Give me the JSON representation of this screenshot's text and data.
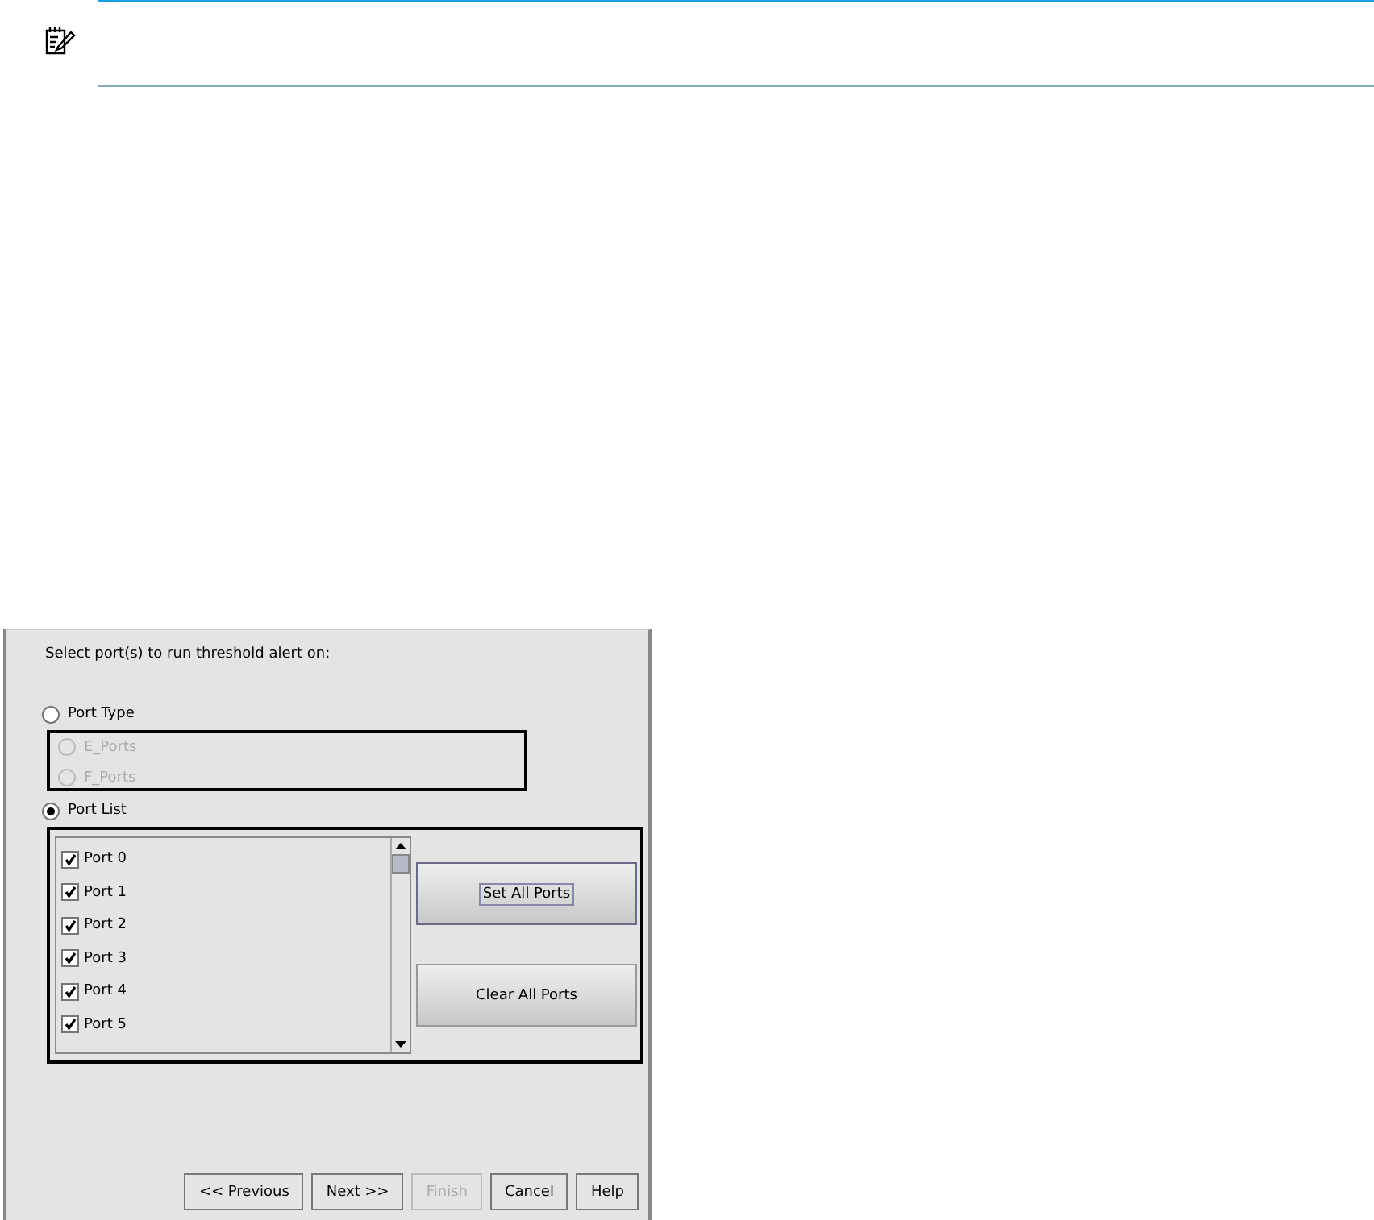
{
  "dialog": {
    "prompt": "Select port(s) to run threshold alert on:",
    "modes": [
      {
        "label": "Port Type",
        "selected": false
      },
      {
        "label": "Port List",
        "selected": true
      }
    ],
    "port_types": [
      {
        "label": "E_Ports",
        "selected": false,
        "disabled": true
      },
      {
        "label": "F_Ports",
        "selected": false,
        "disabled": true
      }
    ],
    "ports": [
      {
        "label": "Port 0",
        "checked": true
      },
      {
        "label": "Port 1",
        "checked": true
      },
      {
        "label": "Port 2",
        "checked": true
      },
      {
        "label": "Port 3",
        "checked": true
      },
      {
        "label": "Port 4",
        "checked": true
      },
      {
        "label": "Port 5",
        "checked": true
      }
    ],
    "side_buttons": [
      {
        "label": "Set All Ports",
        "focused": true
      },
      {
        "label": "Clear All Ports",
        "focused": false
      }
    ],
    "footer_buttons": [
      {
        "label": "<< Previous",
        "disabled": false
      },
      {
        "label": "Next >>",
        "disabled": false
      },
      {
        "label": "Finish",
        "disabled": true
      },
      {
        "label": "Cancel",
        "disabled": false
      },
      {
        "label": "Help",
        "disabled": false
      }
    ]
  }
}
